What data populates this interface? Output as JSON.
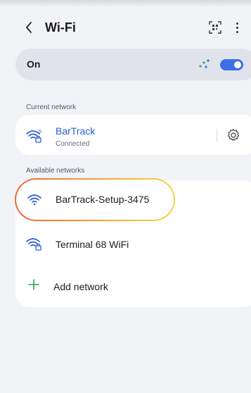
{
  "header": {
    "title": "Wi-Fi",
    "back_icon": "chevron-left-icon",
    "qr_icon": "qr-code-scan-icon",
    "more_icon": "more-vertical-icon"
  },
  "wifi_toggle": {
    "label": "On",
    "enabled": true,
    "accent_color": "#3e6fe3"
  },
  "current_network": {
    "section_label": "Current network",
    "name": "BarTrack",
    "status": "Connected",
    "icon": "wifi-secured-5ghz-icon",
    "settings_icon": "gear-icon",
    "name_color": "#2d5bd6"
  },
  "available_networks": {
    "section_label": "Available networks",
    "items": [
      {
        "name": "BarTrack-Setup-3475",
        "icon": "wifi-open-icon",
        "highlighted": true
      },
      {
        "name": "Terminal 68 WiFi",
        "icon": "wifi-secured-icon",
        "highlighted": false
      }
    ],
    "add_network_label": "Add network",
    "add_icon": "plus-icon",
    "add_icon_color": "#2e9e52"
  }
}
